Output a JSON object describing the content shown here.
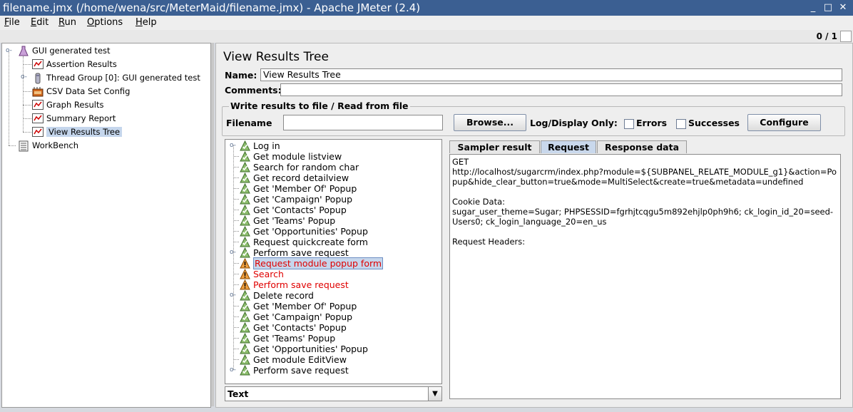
{
  "window": {
    "title": "filename.jmx (/home/wena/src/MeterMaid/filename.jmx) - Apache JMeter (2.4)",
    "minimize": "_",
    "maximize": "□",
    "close": "✕"
  },
  "menu": [
    "File",
    "Edit",
    "Run",
    "Options",
    "Help"
  ],
  "status": {
    "count": "0 / 1"
  },
  "tree": {
    "nodes": [
      {
        "label": "GUI generated test",
        "icon": "test-plan-icon"
      },
      {
        "label": "Assertion Results",
        "icon": "listener-icon"
      },
      {
        "label": "Thread Group [0]: GUI generated test",
        "icon": "thread-group-icon"
      },
      {
        "label": "CSV Data Set Config",
        "icon": "config-icon"
      },
      {
        "label": "Graph Results",
        "icon": "listener-icon"
      },
      {
        "label": "Summary Report",
        "icon": "listener-icon"
      },
      {
        "label": "View Results Tree",
        "icon": "listener-icon"
      },
      {
        "label": "WorkBench",
        "icon": "workbench-icon"
      }
    ]
  },
  "panel": {
    "title": "View Results Tree",
    "name_label": "Name:",
    "name_value": "View Results Tree",
    "comments_label": "Comments:",
    "comments_value": "",
    "group_title": "Write results to file / Read from file",
    "filename_label": "Filename",
    "filename_value": "",
    "browse_label": "Browse...",
    "logdisplay_label": "Log/Display Only:",
    "errors_label": "Errors",
    "successes_label": "Successes",
    "configure_label": "Configure"
  },
  "samples": [
    {
      "label": "Log in",
      "status": "ok",
      "expander": true
    },
    {
      "label": "Get module listview",
      "status": "ok"
    },
    {
      "label": "Search for random char",
      "status": "ok"
    },
    {
      "label": "Get record detailview",
      "status": "ok"
    },
    {
      "label": "Get 'Member Of' Popup",
      "status": "ok"
    },
    {
      "label": "Get 'Campaign' Popup",
      "status": "ok"
    },
    {
      "label": "Get 'Contacts' Popup",
      "status": "ok"
    },
    {
      "label": "Get 'Teams' Popup",
      "status": "ok"
    },
    {
      "label": "Get 'Opportunities' Popup",
      "status": "ok"
    },
    {
      "label": "Request quickcreate form",
      "status": "ok"
    },
    {
      "label": "Perform save request",
      "status": "ok",
      "expander": true
    },
    {
      "label": "Request module popup form",
      "status": "error",
      "selected": true
    },
    {
      "label": "Search",
      "status": "error"
    },
    {
      "label": "Perform save request",
      "status": "error"
    },
    {
      "label": "Delete record",
      "status": "ok",
      "expander": true
    },
    {
      "label": "Get 'Member Of' Popup",
      "status": "ok"
    },
    {
      "label": "Get 'Campaign' Popup",
      "status": "ok"
    },
    {
      "label": "Get 'Contacts' Popup",
      "status": "ok"
    },
    {
      "label": "Get 'Teams' Popup",
      "status": "ok"
    },
    {
      "label": "Get 'Opportunities' Popup",
      "status": "ok"
    },
    {
      "label": "Get module EditView",
      "status": "ok"
    },
    {
      "label": "Perform save request",
      "status": "ok",
      "expander": true
    }
  ],
  "renderer": {
    "selected": "Text"
  },
  "tabs": [
    "Sampler result",
    "Request",
    "Response data"
  ],
  "active_tab": "Request",
  "request": {
    "lines": [
      "GET",
      "http://localhost/sugarcrm/index.php?module=${SUBPANEL_RELATE_MODULE_g1}&action=Popup&hide_clear_button=true&mode=MultiSelect&create=true&metadata=undefined",
      "",
      "Cookie Data:",
      "sugar_user_theme=Sugar; PHPSESSID=fgrhjtcqgu5m892ehjlp0ph9h6; ck_login_id_20=seed-Users0; ck_login_language_20=en_us",
      "",
      "Request Headers:"
    ]
  },
  "colors": {
    "titlebar": "#3b5f92",
    "error_text": "#e00000",
    "selection": "#c5d6ec",
    "active_tab": "#c9d8ec"
  }
}
